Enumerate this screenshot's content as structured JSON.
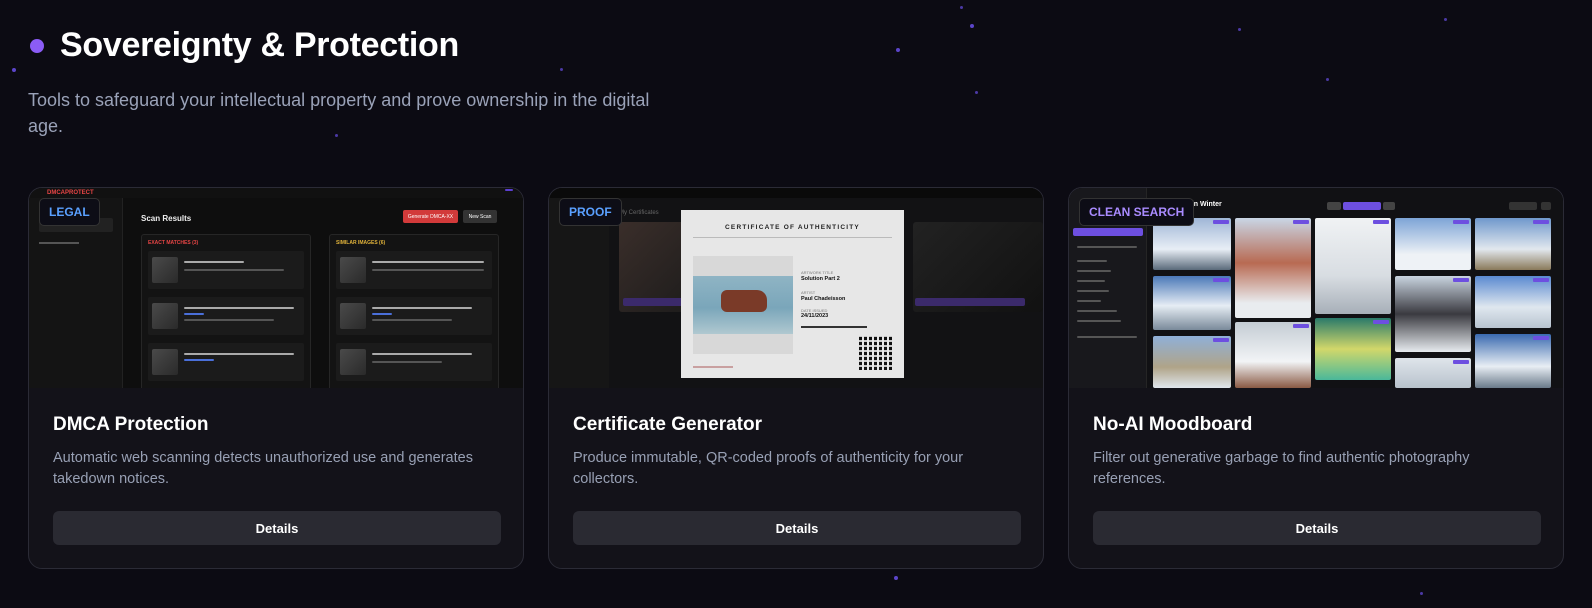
{
  "section": {
    "title": "Sovereignty & Protection",
    "subtitle": "Tools to safeguard your intellectual property and prove ownership in the digital age."
  },
  "colors": {
    "background": "#0c0b13",
    "accent": "#8b5cf6",
    "card_bg": "#131219",
    "button_bg": "#2a2a32"
  },
  "cards": [
    {
      "badge": "LEGAL",
      "title": "DMCA Protection",
      "description": "Automatic web scanning detects unauthorized use and generates takedown notices.",
      "button": "Details",
      "preview": {
        "app_name": "DMCAPROTECT",
        "heading": "Scan Results",
        "primary_button": "Generate DMCA-XX",
        "secondary_button": "New Scan",
        "exact_header": "EXACT MATCHES (3)",
        "similar_header": "SIMILAR IMAGES (6)"
      }
    },
    {
      "badge": "PROOF",
      "title": "Certificate Generator",
      "description": "Produce immutable, QR-coded proofs of authenticity for your collectors.",
      "button": "Details",
      "preview": {
        "certificate_title": "CERTIFICATE OF AUTHENTICITY",
        "artwork_label": "ARTWORK TITLE",
        "artwork_value": "Solution Part 2",
        "artist_label": "ARTIST",
        "artist_value": "Paul Chadeisson",
        "date_label": "DATE ISSUED",
        "date_value": "24/11/2023",
        "panel_title": "My Certificates"
      }
    },
    {
      "badge": "CLEAN SEARCH",
      "title": "No-AI Moodboard",
      "description": "Filter out generative garbage to find authentic photography references.",
      "button": "Details",
      "preview": {
        "board_title": "Castles in Winter"
      }
    }
  ]
}
